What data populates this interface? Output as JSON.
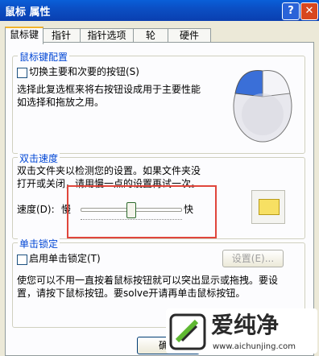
{
  "window": {
    "title": "鼠标 属性",
    "help": "?",
    "close": "✕"
  },
  "tabs": [
    "鼠标键",
    "指针",
    "指针选项",
    "轮",
    "硬件"
  ],
  "button_config": {
    "title": "鼠标键配置",
    "checkbox_label": "切换主要和次要的按钮(S)",
    "desc_line1": "选择此复选框来将右按钮设成用于主要性能",
    "desc_line2": "如选择和拖放之用。"
  },
  "double_click": {
    "title": "双击速度",
    "desc_line1": "双击文件夹以检测您的设置。如果文件夹没",
    "desc_line2": "打开或关闭，请用慢一点的设置再试一次。",
    "speed_label": "速度(D):",
    "slow": "慢",
    "fast": "快",
    "slider_value": 0.5
  },
  "click_lock": {
    "title": "单击锁定",
    "checkbox_label": "启用单击锁定(T)",
    "settings_button": "设置(E)...",
    "desc_line1": "使您可以不用一直按着鼠标按钮就可以突出显示或拖拽。要设",
    "desc_line2": "置，请按下鼠标按钮。要solve开请再单击鼠标按钮。"
  },
  "footer": {
    "ok": "确定"
  },
  "watermark": {
    "brand": "爱纯净",
    "url": "www.aichunjing.com"
  },
  "colors": {
    "accent": "#0046d5",
    "highlight": "#e0463c"
  }
}
